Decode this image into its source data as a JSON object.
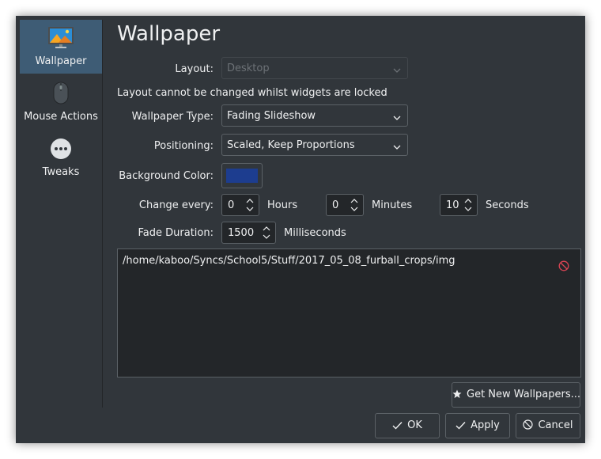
{
  "sidebar": {
    "items": [
      {
        "label": "Wallpaper",
        "icon": "monitor-icon"
      },
      {
        "label": "Mouse Actions",
        "icon": "mouse-icon"
      },
      {
        "label": "Tweaks",
        "icon": "more-icon"
      }
    ]
  },
  "page_title": "Wallpaper",
  "form": {
    "layout_label": "Layout:",
    "layout_value": "Desktop",
    "layout_note": "Layout cannot be changed whilst widgets are locked",
    "type_label": "Wallpaper Type:",
    "type_value": "Fading Slideshow",
    "positioning_label": "Positioning:",
    "positioning_value": "Scaled, Keep Proportions",
    "bgcolor_label": "Background Color:",
    "bgcolor_value": "#1d3d8f",
    "change_label": "Change every:",
    "hours_value": "0",
    "hours_unit": "Hours",
    "minutes_value": "0",
    "minutes_unit": "Minutes",
    "seconds_value": "10",
    "seconds_unit": "Seconds",
    "fade_label": "Fade Duration:",
    "fade_value": "1500",
    "fade_unit": "Milliseconds"
  },
  "folders": [
    "/home/kaboo/Syncs/School5/Stuff/2017_05_08_furball_crops/img"
  ],
  "buttons": {
    "get_new": "Get New Wallpapers...",
    "ok": "OK",
    "apply": "Apply",
    "cancel": "Cancel"
  },
  "colors": {
    "window_bg": "#31363b",
    "selection": "#3e5c75",
    "remove_icon": "#da4453"
  }
}
